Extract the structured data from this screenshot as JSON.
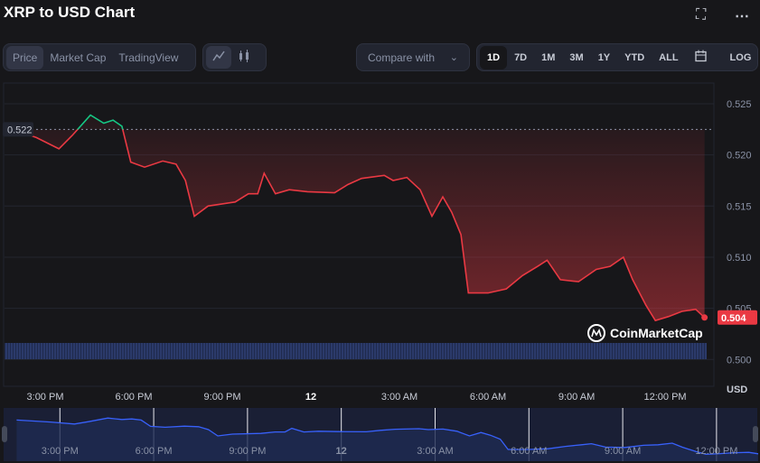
{
  "header": {
    "title": "XRP to USD Chart",
    "fullscreen_icon": "expand-icon",
    "more_icon": "more-horizontal-icon"
  },
  "toolbar": {
    "view_tabs": [
      {
        "label": "Price",
        "selected": true
      },
      {
        "label": "Market Cap"
      },
      {
        "label": "TradingView"
      }
    ],
    "chart_types": [
      "line-chart-icon",
      "candlestick-icon"
    ],
    "compare": {
      "placeholder": "Compare with"
    },
    "ranges": [
      {
        "label": "1D",
        "selected": true
      },
      {
        "label": "7D"
      },
      {
        "label": "1M"
      },
      {
        "label": "3M"
      },
      {
        "label": "1Y"
      },
      {
        "label": "YTD"
      },
      {
        "label": "ALL"
      }
    ],
    "calendar_icon": "calendar-icon",
    "log_label": "LOG"
  },
  "colors": {
    "down": "#ea3943",
    "up": "#16c784",
    "navigator": "#3861fb"
  },
  "watermark": "CoinMarketCap",
  "chart_data": {
    "type": "line",
    "ylabel": "USD",
    "ylim": [
      0.4985,
      0.5265
    ],
    "yticks": [
      "0.525",
      "0.520",
      "0.515",
      "0.510",
      "0.505",
      "0.500"
    ],
    "xticks": [
      "3:00 PM",
      "6:00 PM",
      "9:00 PM",
      "12",
      "3:00 AM",
      "6:00 AM",
      "9:00 AM",
      "12:00 PM"
    ],
    "open_label": "0.522",
    "open_value": 0.5225,
    "last_label": "0.504",
    "grid": true,
    "volume_bars": true,
    "points": [
      [
        "11 13:37",
        0.5228
      ],
      [
        "11 14:42",
        0.5217
      ],
      [
        "11 15:28",
        0.5206
      ],
      [
        "11 15:55",
        0.5219
      ],
      [
        "11 16:32",
        0.5239
      ],
      [
        "11 16:59",
        0.5231
      ],
      [
        "11 17:18",
        0.5234
      ],
      [
        "11 17:36",
        0.5228
      ],
      [
        "11 17:54",
        0.5193
      ],
      [
        "11 18:22",
        0.5188
      ],
      [
        "11 18:59",
        0.5194
      ],
      [
        "11 19:26",
        0.5191
      ],
      [
        "11 19:45",
        0.5175
      ],
      [
        "11 20:03",
        0.514
      ],
      [
        "11 20:31",
        0.515
      ],
      [
        "11 21:26",
        0.5154
      ],
      [
        "11 21:53",
        0.5162
      ],
      [
        "11 22:12",
        0.5162
      ],
      [
        "11 22:25",
        0.5182
      ],
      [
        "11 22:48",
        0.5162
      ],
      [
        "11 23:16",
        0.5166
      ],
      [
        "11 23:53",
        0.5164
      ],
      [
        "12 00:48",
        0.5163
      ],
      [
        "12 01:15",
        0.5171
      ],
      [
        "12 01:43",
        0.5177
      ],
      [
        "12 02:29",
        0.518
      ],
      [
        "12 02:47",
        0.5175
      ],
      [
        "12 03:15",
        0.5178
      ],
      [
        "12 03:42",
        0.5166
      ],
      [
        "12 04:06",
        0.514
      ],
      [
        "12 04:28",
        0.5159
      ],
      [
        "12 04:46",
        0.5144
      ],
      [
        "12 05:05",
        0.5122
      ],
      [
        "12 05:20",
        0.5065
      ],
      [
        "12 06:00",
        0.5065
      ],
      [
        "12 06:37",
        0.5069
      ],
      [
        "12 07:10",
        0.5082
      ],
      [
        "12 07:41",
        0.5091
      ],
      [
        "12 08:00",
        0.5097
      ],
      [
        "12 08:27",
        0.5078
      ],
      [
        "12 09:04",
        0.5076
      ],
      [
        "12 09:40",
        0.5088
      ],
      [
        "12 10:08",
        0.5091
      ],
      [
        "12 10:35",
        0.51
      ],
      [
        "12 10:54",
        0.5078
      ],
      [
        "12 11:21",
        0.5053
      ],
      [
        "12 11:40",
        0.5038
      ],
      [
        "12 12:07",
        0.5042
      ],
      [
        "12 12:34",
        0.5047
      ],
      [
        "12 13:02",
        0.5049
      ],
      [
        "12 13:20",
        0.5041
      ]
    ]
  }
}
